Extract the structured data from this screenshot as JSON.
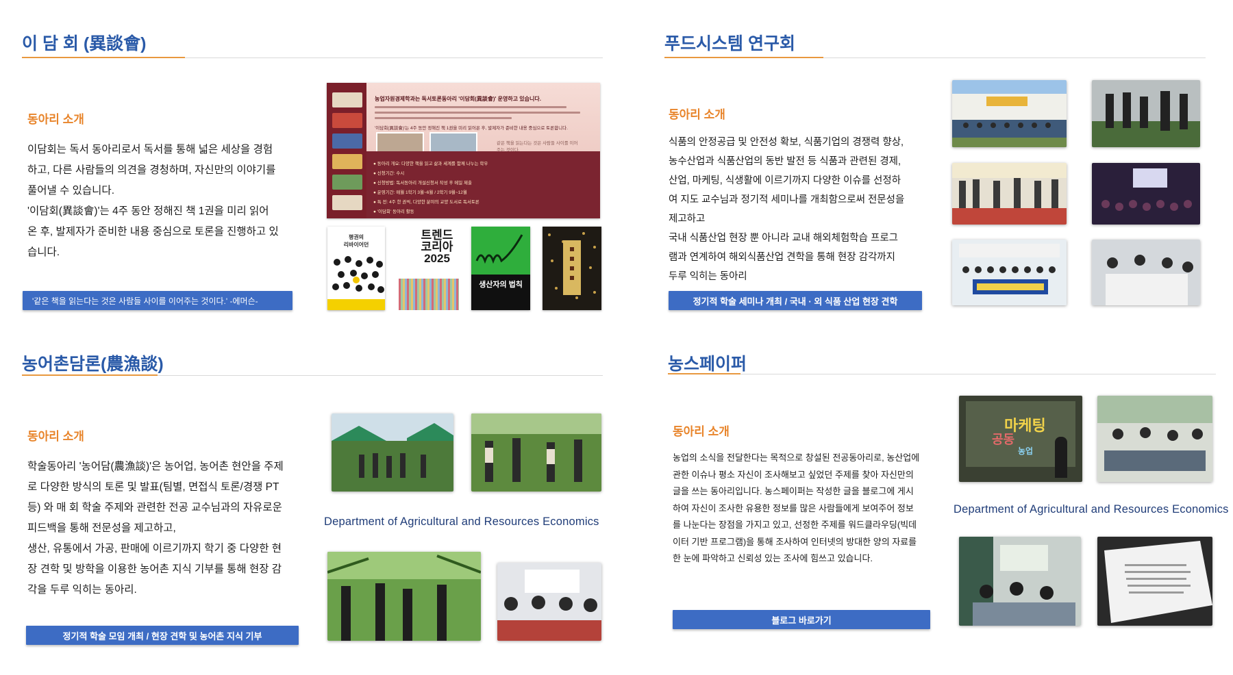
{
  "sections": {
    "idamhoe": {
      "title": "이 담 회 (異談會)",
      "intro_label": "동아리 소개",
      "paragraphs": [
        " 이담회는 독서 동아리로서 독서를 통해 넓은 세상을 경험",
        "하고, 다른 사람들의 의견을 경청하며, 자신만의 이야기를",
        "풀어낼 수 있습니다.",
        " '이담회(異談會)'는 4주 동안 정해진 책 1권을 미리 읽어",
        "온 후, 발제자가 준비한 내용 중심으로 토론을 진행하고 있",
        "습니다."
      ],
      "quote": "'같은 책을 읽는다는 것은 사람들 사이를 이어주는 것이다.' -에머슨-",
      "poster": {
        "headline": "농업자원경제학과는 독서토론동아리 '이담회(異談會)' 운영하고 있습니다.",
        "subline": "'이담회(異談會)'는 4주 동안 정해진 책 1권을 미리 읽어온 후, 발제자가 준비한 내용 중심으로 토론합니다.",
        "quote": "같은 책을 읽는다는 것은 사람들 사이를 이어주는 것이다.",
        "items": [
          "● 동아리 개요: 다양한 책을 읽고 삶과 세계를 함께 나누는 학우",
          "● 신청기간: 수시",
          "● 신청방법: 독서동아리 개설신청서 작성 후 메일 제출",
          "● 운영기간: 매월 1학기 3월~6월 / 2학기 9월~12월",
          "● 특 전: 4주 한 권씩, 다양한 분야의 교양 도서로 독서토론",
          "● '이담회' 동아리 활동"
        ]
      },
      "books": [
        {
          "title": "평권의\n리바이어던",
          "bg": "#ffffff"
        },
        {
          "title": "트렌드\n코리아\n2025",
          "bg": "#ffffff"
        },
        {
          "title": "생산자의 법칙",
          "bg": "#2fae3c"
        },
        {
          "title": "",
          "bg": "#1e1a14"
        }
      ]
    },
    "foodsystem": {
      "title": "푸드시스템 연구회",
      "intro_label": "동아리 소개",
      "paragraphs": [
        " 식품의 안정공급 및 안전성 확보, 식품기업의 경쟁력 향상,",
        "농수산업과 식품산업의 동반 발전 등 식품과 관련된 경제,",
        "산업, 마케팅, 식생활에 이르기까지 다양한 이슈를 선정하",
        "여 지도 교수님과 정기적 세미나를 개최함으로써 전문성을",
        "제고하고",
        "국내 식품산업 현장 뿐 아니라 교내 해외체험학습 프로그",
        "램과 연계하여 해외식품산업 견학을 통해 현장 감각까지",
        "두루 익히는 동아리"
      ],
      "bar": "정기적 학술 세미나 개최  /  국내 · 외 식품 산업 현장 견학"
    },
    "nongeochon": {
      "title": "농어촌담론(農漁談)",
      "intro_label": "동아리 소개",
      "paragraphs": [
        " 학술동아리 '농어담(農漁談)'은 농어업, 농어촌 현안을 주제",
        "로 다양한 방식의 토론 및 발표(팀별, 면접식 토론/경쟁 PT",
        "등) 와 매 회 학술 주제와 관련한 전공 교수님과의 자유로운",
        "피드백을 통해 전문성을 제고하고,",
        " 생산, 유통에서 가공, 판매에 이르기까지 학기 중 다양한 현",
        "장 견학 및 방학을 이용한 농어촌 지식 기부를 통해 현장 감",
        "각을 두루 익히는 동아리."
      ],
      "dept": "Department of Agricultural and Resources Economics",
      "bar": "정기적 학술 모임 개최  /  현장 견학 및 농어촌 지식 기부"
    },
    "nongspaper": {
      "title": "농스페이퍼",
      "intro_label": "동아리 소개",
      "paragraphs": [
        "농업의 소식을 전달한다는 목적으로 창설된 전공동아리로, 농산업에",
        "관한 이슈나 평소 자신이 조사해보고 싶었던 주제를 찾아 자신만의",
        "글을 쓰는 동아리입니다. 농스페이퍼는 작성한 글을 블로그에 게시",
        "하여 자신이 조사한 유용한 정보를 많은 사람들에게 보여주어 정보",
        "를 나눈다는 장점을 가지고 있고, 선정한 주제를 워드클라우딩(빅데",
        "이터 기반 프로그램)을 통해 조사하여 인터넷의 방대한 양의 자료를",
        "한 눈에 파악하고 신뢰성 있는 조사에 힘쓰고 있습니다."
      ],
      "dept": "Department of Agricultural and Resources Economics",
      "bar": "블로그 바로가기",
      "wordcloud": {
        "main": "마케팅",
        "second": "공동",
        "third": "농업"
      }
    }
  },
  "colors": {
    "title_blue": "#2a5aa8",
    "accent_orange": "#e8842a",
    "bar_blue": "#3d6cc4"
  }
}
